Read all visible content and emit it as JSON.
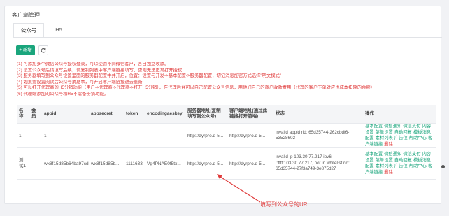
{
  "page": {
    "title": "客户端管理"
  },
  "tabs": [
    {
      "label": "公众号",
      "active": true
    },
    {
      "label": "H5",
      "active": false
    }
  ],
  "toolbar": {
    "add_label": "+ 新增",
    "refresh_icon": "refresh-icon"
  },
  "notes": [
    "(1) 可添加多个微信公众号授权登录，可以使用不同微信客户，各自独立收款。",
    "(2) 设置公众号后请填写后续，请复制列表中客户端链接填写，否则无法正常打开授权",
    "(3) 服务器填写到公众号设置里面的服务器配置中并开启，位置：设置与开发->基本配置->服务器配置，切记消息加密方式选择\"明文模式\"",
    "(4) 如果要设置阅读后公众号消息事，可开启客户端链接进去重新!",
    "(5) 可以打开代理商的H5分销功能（用户->代理商->代理商->打开H5分销），在代理后台可以自己配置公众号信息，用他们自己的商户收款费用（代理的客户下单对应也成本扣除的余额）",
    "(6) 代理端添加的公众号和H5不需备份销功能。"
  ],
  "table": {
    "headers": [
      "名称",
      "会员",
      "appid",
      "appsecret",
      "token",
      "encodingaeskey",
      "服务器地址(复制填写到公众号)",
      "客户端地址(通过此链接打开前端)",
      "状态",
      "操作"
    ],
    "rows": [
      {
        "name": "1",
        "member": "-",
        "appid": "1",
        "appsecret": "",
        "token": "",
        "encodingaeskey": "",
        "server_url": "http://dyrpro.d-5...",
        "client_url": "http://dyrpro.d-5...",
        "status": "invalid appid rid: 65d35744-262cbdf6-53528602"
      },
      {
        "name": "测试1",
        "member": "-",
        "appid": "wx8f15d85b64ba97cd",
        "appsecret": "wx8f15d85b...",
        "token": "1111633",
        "encodingaeskey": "Vg4PNAE0f5tx...",
        "server_url": "http://dyrpro.d-5...",
        "client_url": "http://dyrpro.d-5...",
        "status": "invalid ip 103.30.77.217 ipv6 ::ffff:103.30.77.217, not in whitelist rid: 65d35744-27f3a749-3e875d27"
      }
    ],
    "actions": [
      "基本配置",
      "微信通知",
      "微信支付",
      "内容设置",
      "菜单设置",
      "自动回复",
      "模板消息",
      "配置",
      "素材列表",
      "广告位",
      "帮助中心",
      "客户端链接",
      "删除"
    ]
  },
  "annotation": "填写到公众号的URL",
  "colors": {
    "accent": "#1aa57c",
    "danger": "#e03b3b"
  }
}
